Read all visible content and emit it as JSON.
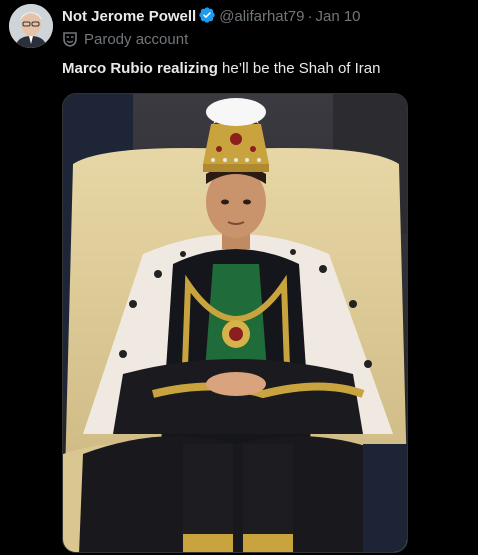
{
  "post": {
    "display_name": "Not Jerome Powell",
    "handle": "@alifarhat79",
    "separator": "·",
    "date": "Jan 10",
    "parody_label": "Parody account",
    "text_bold": "Marco Rubio realizing",
    "text_rest": " he’ll be the Shah of Iran"
  },
  "icons": {
    "verified": "verified-badge-icon",
    "parody": "parody-mask-icon"
  },
  "colors": {
    "background": "#000000",
    "primary_text": "#e7e9ea",
    "secondary_text": "#71767b",
    "verified_blue": "#1d9bf0"
  }
}
